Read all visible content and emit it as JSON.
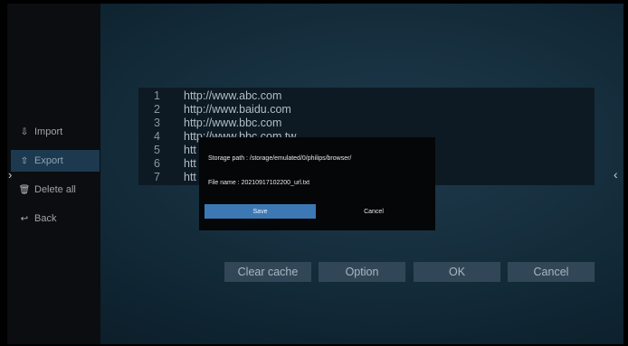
{
  "sidebar": {
    "items": [
      {
        "label": "Import",
        "icon": "import-icon",
        "glyph": "⇩"
      },
      {
        "label": "Export",
        "icon": "export-icon",
        "glyph": "⇧"
      },
      {
        "label": "Delete all",
        "icon": "trash-icon",
        "glyph": "🗑"
      },
      {
        "label": "Back",
        "icon": "back-arrow-icon",
        "glyph": "↩"
      }
    ],
    "selected_index": 1,
    "expand_icon": "chevron-right-icon",
    "expand_glyph": "›"
  },
  "panel_arrow": {
    "icon": "chevron-left-icon",
    "glyph": "‹"
  },
  "url_list": {
    "rows": [
      {
        "num": "1",
        "url": "http://www.abc.com"
      },
      {
        "num": "2",
        "url": "http://www.baidu.com"
      },
      {
        "num": "3",
        "url": "http://www.bbc.com"
      },
      {
        "num": "4",
        "url": "http://www.bbc.com.tw"
      },
      {
        "num": "5",
        "url": "htt"
      },
      {
        "num": "6",
        "url": "htt"
      },
      {
        "num": "7",
        "url": "htt"
      }
    ]
  },
  "buttons": {
    "clear_cache": "Clear cache",
    "option": "Option",
    "ok": "OK",
    "cancel": "Cancel"
  },
  "dialog": {
    "storage_path": "Storage path : /storage/emulated/0/philips/browser/",
    "file_name": "File name : 20210917102200_url.txt",
    "save": "Save",
    "cancel": "Cancel"
  },
  "colors": {
    "accent": "#3c79b4",
    "selected_bg": "#1c3950",
    "button_bg": "#314758"
  }
}
